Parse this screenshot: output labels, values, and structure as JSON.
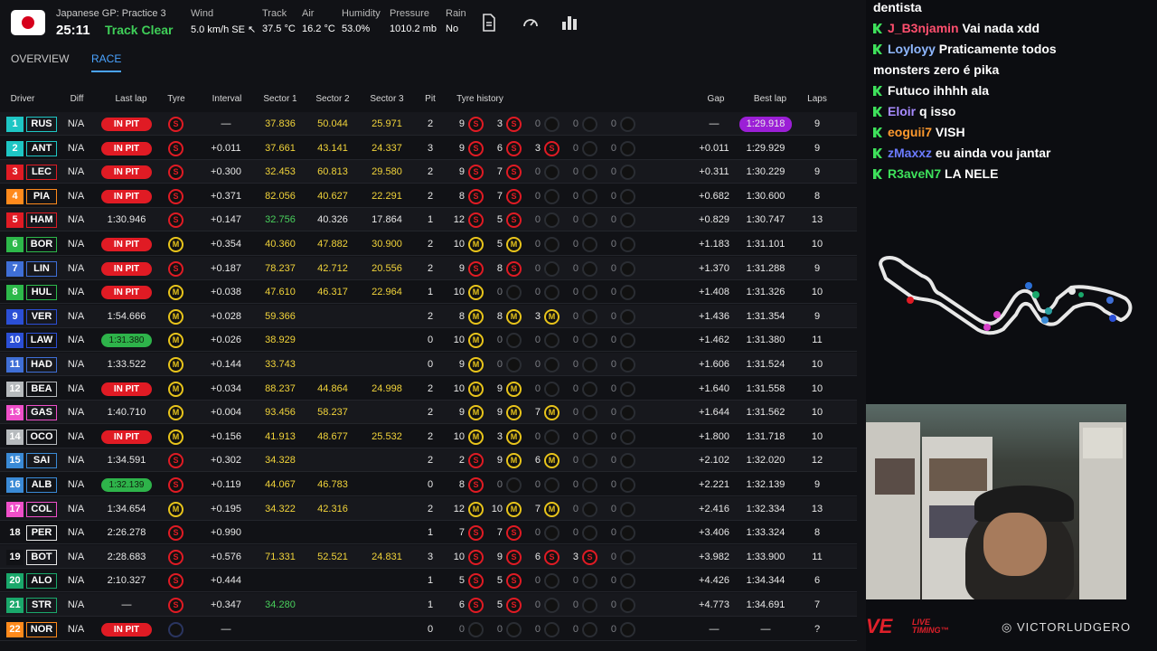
{
  "session": {
    "name": "Japanese GP: Practice 3",
    "clock": "25:11",
    "track_status": "Track Clear"
  },
  "weather": {
    "wind": {
      "label": "Wind",
      "value": "5.0 km/h SE ↖"
    },
    "track": {
      "label": "Track",
      "value": "37.5 °C"
    },
    "air": {
      "label": "Air",
      "value": "16.2 °C"
    },
    "humidity": {
      "label": "Humidity",
      "value": "53.0%"
    },
    "pressure": {
      "label": "Pressure",
      "value": "1010.2 mb"
    },
    "rain": {
      "label": "Rain",
      "value": "No"
    }
  },
  "tabs": [
    "OVERVIEW",
    "RACE"
  ],
  "columns": [
    "Driver",
    "Diff",
    "Last lap",
    "Tyre",
    "Interval",
    "Sector 1",
    "Sector 2",
    "Sector 3",
    "Pit",
    "Tyre history",
    "Gap",
    "Best lap",
    "Laps"
  ],
  "colors": {
    "pit": "#e01b24",
    "soft": "#e01b24",
    "medium": "#e8c41b",
    "best_overall": "#9b1fd6",
    "personal_best": "#2eb34a",
    "green_text": "#49d05c",
    "yellow_text": "#f2d43a",
    "track_clear": "#3fcf58"
  },
  "drivers": [
    {
      "pos": "1",
      "code": "RUS",
      "team": "#1ec6c4",
      "diff": "N/A",
      "last": "IN PIT",
      "last_type": "pit",
      "tyre": "S",
      "interval": "—",
      "s1": "37.836",
      "s1c": "y",
      "s2": "50.044",
      "s2c": "y",
      "s3": "25.971",
      "s3c": "y",
      "pit": "2",
      "hist": [
        [
          "9",
          "S"
        ],
        [
          "3",
          "S"
        ],
        [
          "0",
          "E"
        ],
        [
          "0",
          "E"
        ],
        [
          "0",
          "E"
        ]
      ],
      "gap": "—",
      "best": "1:29.918",
      "best_type": "overall",
      "laps": "9"
    },
    {
      "pos": "2",
      "code": "ANT",
      "team": "#1ec6c4",
      "diff": "N/A",
      "last": "IN PIT",
      "last_type": "pit",
      "tyre": "S",
      "interval": "+0.011",
      "s1": "37.661",
      "s1c": "y",
      "s2": "43.141",
      "s2c": "y",
      "s3": "24.337",
      "s3c": "y",
      "pit": "3",
      "hist": [
        [
          "9",
          "S"
        ],
        [
          "6",
          "S"
        ],
        [
          "3",
          "S"
        ],
        [
          "0",
          "E"
        ],
        [
          "0",
          "E"
        ]
      ],
      "gap": "+0.011",
      "best": "1:29.929",
      "best_type": "",
      "laps": "9"
    },
    {
      "pos": "3",
      "code": "LEC",
      "team": "#e01b24",
      "diff": "N/A",
      "last": "IN PIT",
      "last_type": "pit",
      "tyre": "S",
      "interval": "+0.300",
      "s1": "32.453",
      "s1c": "y",
      "s2": "60.813",
      "s2c": "y",
      "s3": "29.580",
      "s3c": "y",
      "pit": "2",
      "hist": [
        [
          "9",
          "S"
        ],
        [
          "7",
          "S"
        ],
        [
          "0",
          "E"
        ],
        [
          "0",
          "E"
        ],
        [
          "0",
          "E"
        ]
      ],
      "gap": "+0.311",
      "best": "1:30.229",
      "best_type": "",
      "laps": "9"
    },
    {
      "pos": "4",
      "code": "PIA",
      "team": "#ff8a1c",
      "diff": "N/A",
      "last": "IN PIT",
      "last_type": "pit",
      "tyre": "S",
      "interval": "+0.371",
      "s1": "82.056",
      "s1c": "y",
      "s2": "40.627",
      "s2c": "y",
      "s3": "22.291",
      "s3c": "y",
      "pit": "2",
      "hist": [
        [
          "8",
          "S"
        ],
        [
          "7",
          "S"
        ],
        [
          "0",
          "E"
        ],
        [
          "0",
          "E"
        ],
        [
          "0",
          "E"
        ]
      ],
      "gap": "+0.682",
      "best": "1:30.600",
      "best_type": "",
      "laps": "8"
    },
    {
      "pos": "5",
      "code": "HAM",
      "team": "#e01b24",
      "diff": "N/A",
      "last": "1:30.946",
      "last_type": "",
      "tyre": "S",
      "interval": "+0.147",
      "s1": "32.756",
      "s1c": "g",
      "s2": "40.326",
      "s2c": "w",
      "s3": "17.864",
      "s3c": "w",
      "pit": "1",
      "hist": [
        [
          "12",
          "S"
        ],
        [
          "5",
          "S"
        ],
        [
          "0",
          "E"
        ],
        [
          "0",
          "E"
        ],
        [
          "0",
          "E"
        ]
      ],
      "gap": "+0.829",
      "best": "1:30.747",
      "best_type": "",
      "laps": "13"
    },
    {
      "pos": "6",
      "code": "BOR",
      "team": "#2db84a",
      "diff": "N/A",
      "last": "IN PIT",
      "last_type": "pit",
      "tyre": "M",
      "interval": "+0.354",
      "s1": "40.360",
      "s1c": "y",
      "s2": "47.882",
      "s2c": "y",
      "s3": "30.900",
      "s3c": "y",
      "pit": "2",
      "hist": [
        [
          "10",
          "M"
        ],
        [
          "5",
          "M"
        ],
        [
          "0",
          "E"
        ],
        [
          "0",
          "E"
        ],
        [
          "0",
          "E"
        ]
      ],
      "gap": "+1.183",
      "best": "1:31.101",
      "best_type": "",
      "laps": "10"
    },
    {
      "pos": "7",
      "code": "LIN",
      "team": "#3f6fd6",
      "diff": "N/A",
      "last": "IN PIT",
      "last_type": "pit",
      "tyre": "S",
      "interval": "+0.187",
      "s1": "78.237",
      "s1c": "y",
      "s2": "42.712",
      "s2c": "y",
      "s3": "20.556",
      "s3c": "y",
      "pit": "2",
      "hist": [
        [
          "9",
          "S"
        ],
        [
          "8",
          "S"
        ],
        [
          "0",
          "E"
        ],
        [
          "0",
          "E"
        ],
        [
          "0",
          "E"
        ]
      ],
      "gap": "+1.370",
      "best": "1:31.288",
      "best_type": "",
      "laps": "9"
    },
    {
      "pos": "8",
      "code": "HUL",
      "team": "#2db84a",
      "diff": "N/A",
      "last": "IN PIT",
      "last_type": "pit",
      "tyre": "M",
      "interval": "+0.038",
      "s1": "47.610",
      "s1c": "y",
      "s2": "46.317",
      "s2c": "y",
      "s3": "22.964",
      "s3c": "y",
      "pit": "1",
      "hist": [
        [
          "10",
          "M"
        ],
        [
          "0",
          "E"
        ],
        [
          "0",
          "E"
        ],
        [
          "0",
          "E"
        ],
        [
          "0",
          "E"
        ]
      ],
      "gap": "+1.408",
      "best": "1:31.326",
      "best_type": "",
      "laps": "10"
    },
    {
      "pos": "9",
      "code": "VER",
      "team": "#2b4fd6",
      "diff": "N/A",
      "last": "1:54.666",
      "last_type": "",
      "tyre": "M",
      "interval": "+0.028",
      "s1": "59.366",
      "s1c": "y",
      "s2": "",
      "s2c": "w",
      "s3": "",
      "s3c": "w",
      "pit": "2",
      "hist": [
        [
          "8",
          "M"
        ],
        [
          "8",
          "M"
        ],
        [
          "3",
          "M"
        ],
        [
          "0",
          "E"
        ],
        [
          "0",
          "E"
        ]
      ],
      "gap": "+1.436",
      "best": "1:31.354",
      "best_type": "",
      "laps": "9"
    },
    {
      "pos": "10",
      "code": "LAW",
      "team": "#2b4fd6",
      "diff": "N/A",
      "last": "1:31.380",
      "last_type": "pb",
      "tyre": "M",
      "interval": "+0.026",
      "s1": "38.929",
      "s1c": "y",
      "s2": "",
      "s2c": "w",
      "s3": "",
      "s3c": "w",
      "pit": "0",
      "hist": [
        [
          "10",
          "M"
        ],
        [
          "0",
          "E"
        ],
        [
          "0",
          "E"
        ],
        [
          "0",
          "E"
        ],
        [
          "0",
          "E"
        ]
      ],
      "gap": "+1.462",
      "best": "1:31.380",
      "best_type": "",
      "laps": "11"
    },
    {
      "pos": "11",
      "code": "HAD",
      "team": "#3f6fd6",
      "diff": "N/A",
      "last": "1:33.522",
      "last_type": "",
      "tyre": "M",
      "interval": "+0.144",
      "s1": "33.743",
      "s1c": "y",
      "s2": "",
      "s2c": "w",
      "s3": "",
      "s3c": "w",
      "pit": "0",
      "hist": [
        [
          "9",
          "M"
        ],
        [
          "0",
          "E"
        ],
        [
          "0",
          "E"
        ],
        [
          "0",
          "E"
        ],
        [
          "0",
          "E"
        ]
      ],
      "gap": "+1.606",
      "best": "1:31.524",
      "best_type": "",
      "laps": "10"
    },
    {
      "pos": "12",
      "code": "BEA",
      "team": "#b6babd",
      "diff": "N/A",
      "last": "IN PIT",
      "last_type": "pit",
      "tyre": "M",
      "interval": "+0.034",
      "s1": "88.237",
      "s1c": "y",
      "s2": "44.864",
      "s2c": "y",
      "s3": "24.998",
      "s3c": "y",
      "pit": "2",
      "hist": [
        [
          "10",
          "M"
        ],
        [
          "9",
          "M"
        ],
        [
          "0",
          "E"
        ],
        [
          "0",
          "E"
        ],
        [
          "0",
          "E"
        ]
      ],
      "gap": "+1.640",
      "best": "1:31.558",
      "best_type": "",
      "laps": "10"
    },
    {
      "pos": "13",
      "code": "GAS",
      "team": "#ef4fc9",
      "diff": "N/A",
      "last": "1:40.710",
      "last_type": "",
      "tyre": "M",
      "interval": "+0.004",
      "s1": "93.456",
      "s1c": "y",
      "s2": "58.237",
      "s2c": "y",
      "s3": "",
      "s3c": "w",
      "pit": "2",
      "hist": [
        [
          "9",
          "M"
        ],
        [
          "9",
          "M"
        ],
        [
          "7",
          "M"
        ],
        [
          "0",
          "E"
        ],
        [
          "0",
          "E"
        ]
      ],
      "gap": "+1.644",
      "best": "1:31.562",
      "best_type": "",
      "laps": "10"
    },
    {
      "pos": "14",
      "code": "OCO",
      "team": "#b6babd",
      "diff": "N/A",
      "last": "IN PIT",
      "last_type": "pit",
      "tyre": "M",
      "interval": "+0.156",
      "s1": "41.913",
      "s1c": "y",
      "s2": "48.677",
      "s2c": "y",
      "s3": "25.532",
      "s3c": "y",
      "pit": "2",
      "hist": [
        [
          "10",
          "M"
        ],
        [
          "3",
          "M"
        ],
        [
          "0",
          "E"
        ],
        [
          "0",
          "E"
        ],
        [
          "0",
          "E"
        ]
      ],
      "gap": "+1.800",
      "best": "1:31.718",
      "best_type": "",
      "laps": "10"
    },
    {
      "pos": "15",
      "code": "SAI",
      "team": "#3a8ad6",
      "diff": "N/A",
      "last": "1:34.591",
      "last_type": "",
      "tyre": "S",
      "interval": "+0.302",
      "s1": "34.328",
      "s1c": "y",
      "s2": "",
      "s2c": "w",
      "s3": "",
      "s3c": "w",
      "pit": "2",
      "hist": [
        [
          "2",
          "S"
        ],
        [
          "9",
          "M"
        ],
        [
          "6",
          "M"
        ],
        [
          "0",
          "E"
        ],
        [
          "0",
          "E"
        ]
      ],
      "gap": "+2.102",
      "best": "1:32.020",
      "best_type": "",
      "laps": "12"
    },
    {
      "pos": "16",
      "code": "ALB",
      "team": "#3a8ad6",
      "diff": "N/A",
      "last": "1:32.139",
      "last_type": "pb",
      "tyre": "S",
      "interval": "+0.119",
      "s1": "44.067",
      "s1c": "y",
      "s2": "46.783",
      "s2c": "y",
      "s3": "",
      "s3c": "w",
      "pit": "0",
      "hist": [
        [
          "8",
          "S"
        ],
        [
          "0",
          "E"
        ],
        [
          "0",
          "E"
        ],
        [
          "0",
          "E"
        ],
        [
          "0",
          "E"
        ]
      ],
      "gap": "+2.221",
      "best": "1:32.139",
      "best_type": "",
      "laps": "9"
    },
    {
      "pos": "17",
      "code": "COL",
      "team": "#ef4fc9",
      "diff": "N/A",
      "last": "1:34.654",
      "last_type": "",
      "tyre": "M",
      "interval": "+0.195",
      "s1": "34.322",
      "s1c": "y",
      "s2": "42.316",
      "s2c": "y",
      "s3": "",
      "s3c": "w",
      "pit": "2",
      "hist": [
        [
          "12",
          "M"
        ],
        [
          "10",
          "M"
        ],
        [
          "7",
          "M"
        ],
        [
          "0",
          "E"
        ],
        [
          "0",
          "E"
        ]
      ],
      "gap": "+2.416",
      "best": "1:32.334",
      "best_type": "",
      "laps": "13"
    },
    {
      "pos": "18",
      "code": "PER",
      "team": "#111216",
      "diff": "N/A",
      "last": "2:26.278",
      "last_type": "",
      "tyre": "S",
      "interval": "+0.990",
      "s1": "",
      "s1c": "w",
      "s2": "",
      "s2c": "w",
      "s3": "",
      "s3c": "w",
      "pit": "1",
      "hist": [
        [
          "7",
          "S"
        ],
        [
          "7",
          "S"
        ],
        [
          "0",
          "E"
        ],
        [
          "0",
          "E"
        ],
        [
          "0",
          "E"
        ]
      ],
      "gap": "+3.406",
      "best": "1:33.324",
      "best_type": "",
      "laps": "8"
    },
    {
      "pos": "19",
      "code": "BOT",
      "team": "#111216",
      "diff": "N/A",
      "last": "2:28.683",
      "last_type": "",
      "tyre": "S",
      "interval": "+0.576",
      "s1": "71.331",
      "s1c": "y",
      "s2": "52.521",
      "s2c": "y",
      "s3": "24.831",
      "s3c": "y",
      "pit": "3",
      "hist": [
        [
          "10",
          "S"
        ],
        [
          "9",
          "S"
        ],
        [
          "6",
          "S"
        ],
        [
          "3",
          "S"
        ],
        [
          "0",
          "E"
        ]
      ],
      "gap": "+3.982",
      "best": "1:33.900",
      "best_type": "",
      "laps": "11"
    },
    {
      "pos": "20",
      "code": "ALO",
      "team": "#1aa86b",
      "diff": "N/A",
      "last": "2:10.327",
      "last_type": "",
      "tyre": "S",
      "interval": "+0.444",
      "s1": "",
      "s1c": "w",
      "s2": "",
      "s2c": "w",
      "s3": "",
      "s3c": "w",
      "pit": "1",
      "hist": [
        [
          "5",
          "S"
        ],
        [
          "5",
          "S"
        ],
        [
          "0",
          "E"
        ],
        [
          "0",
          "E"
        ],
        [
          "0",
          "E"
        ]
      ],
      "gap": "+4.426",
      "best": "1:34.344",
      "best_type": "",
      "laps": "6"
    },
    {
      "pos": "21",
      "code": "STR",
      "team": "#1aa86b",
      "diff": "N/A",
      "last": "—",
      "last_type": "",
      "tyre": "S",
      "interval": "+0.347",
      "s1": "34.280",
      "s1c": "g",
      "s2": "",
      "s2c": "w",
      "s3": "",
      "s3c": "w",
      "pit": "1",
      "hist": [
        [
          "6",
          "S"
        ],
        [
          "5",
          "S"
        ],
        [
          "0",
          "E"
        ],
        [
          "0",
          "E"
        ],
        [
          "0",
          "E"
        ]
      ],
      "gap": "+4.773",
      "best": "1:34.691",
      "best_type": "",
      "laps": "7"
    },
    {
      "pos": "22",
      "code": "NOR",
      "team": "#ff8a1c",
      "diff": "N/A",
      "last": "IN PIT",
      "last_type": "pit",
      "tyre": "X",
      "interval": "—",
      "s1": "",
      "s1c": "w",
      "s2": "",
      "s2c": "w",
      "s3": "",
      "s3c": "w",
      "pit": "0",
      "hist": [
        [
          "0",
          "E"
        ],
        [
          "0",
          "E"
        ],
        [
          "0",
          "E"
        ],
        [
          "0",
          "E"
        ],
        [
          "0",
          "E"
        ]
      ],
      "gap": "—",
      "best": "—",
      "best_type": "",
      "laps": "?"
    }
  ],
  "chat": [
    {
      "user": "",
      "user_color": "#ffffff",
      "text": "dentista",
      "badge": false
    },
    {
      "user": "J_B3njamin",
      "user_color": "#ff4f6e",
      "text": "Vai nada xdd",
      "badge": true
    },
    {
      "user": "Loyloyy",
      "user_color": "#8fb8ff",
      "text": "Praticamente todos",
      "badge": true
    },
    {
      "user": "",
      "user_color": "#ffffff",
      "text": "monsters zero é pika",
      "badge": false
    },
    {
      "user": "Futuco",
      "user_color": "#ffffff",
      "text": "ihhhh ala",
      "badge": true
    },
    {
      "user": "Eloir",
      "user_color": "#a78bff",
      "text": "q isso",
      "badge": true
    },
    {
      "user": "eoguii7",
      "user_color": "#ff9a2e",
      "text": "VISH",
      "badge": true
    },
    {
      "user": "zMaxxz",
      "user_color": "#6b7bff",
      "text": "eu ainda vou jantar",
      "badge": true
    },
    {
      "user": "R3aveN7",
      "user_color": "#3ee15b",
      "text": "LA NELE",
      "badge": true
    }
  ],
  "footer": {
    "brand": "VE",
    "brand_sub_1": "LIVE",
    "brand_sub_2": "TIMING™",
    "handle": "VICTORLUDGERO"
  }
}
